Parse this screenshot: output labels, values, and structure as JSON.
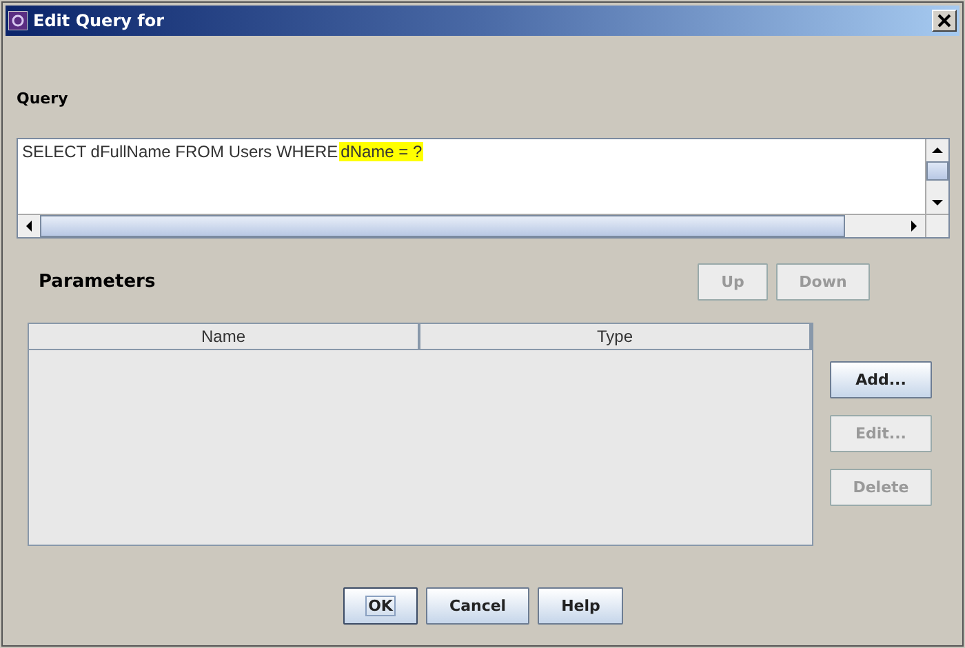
{
  "window": {
    "title": "Edit Query for"
  },
  "query": {
    "label": "Query",
    "segments": [
      {
        "text": "SELECT dFullName FROM Users WHERE",
        "highlighted": false
      },
      {
        "text": "dName = ?",
        "highlighted": true
      }
    ]
  },
  "parameters": {
    "label": "Parameters",
    "order_buttons": [
      {
        "label": "Up",
        "disabled": true
      },
      {
        "label": "Down",
        "disabled": true
      }
    ],
    "table": {
      "columns": [
        "Name",
        "Type"
      ]
    },
    "side_buttons": [
      {
        "label": "Add...",
        "disabled": false
      },
      {
        "label": "Edit...",
        "disabled": true
      },
      {
        "label": "Delete",
        "disabled": true
      }
    ]
  },
  "buttons": [
    {
      "label": "OK",
      "disabled": false,
      "focused": true
    },
    {
      "label": "Cancel",
      "disabled": false,
      "focused": false
    },
    {
      "label": "Help",
      "disabled": false,
      "focused": false
    }
  ]
}
